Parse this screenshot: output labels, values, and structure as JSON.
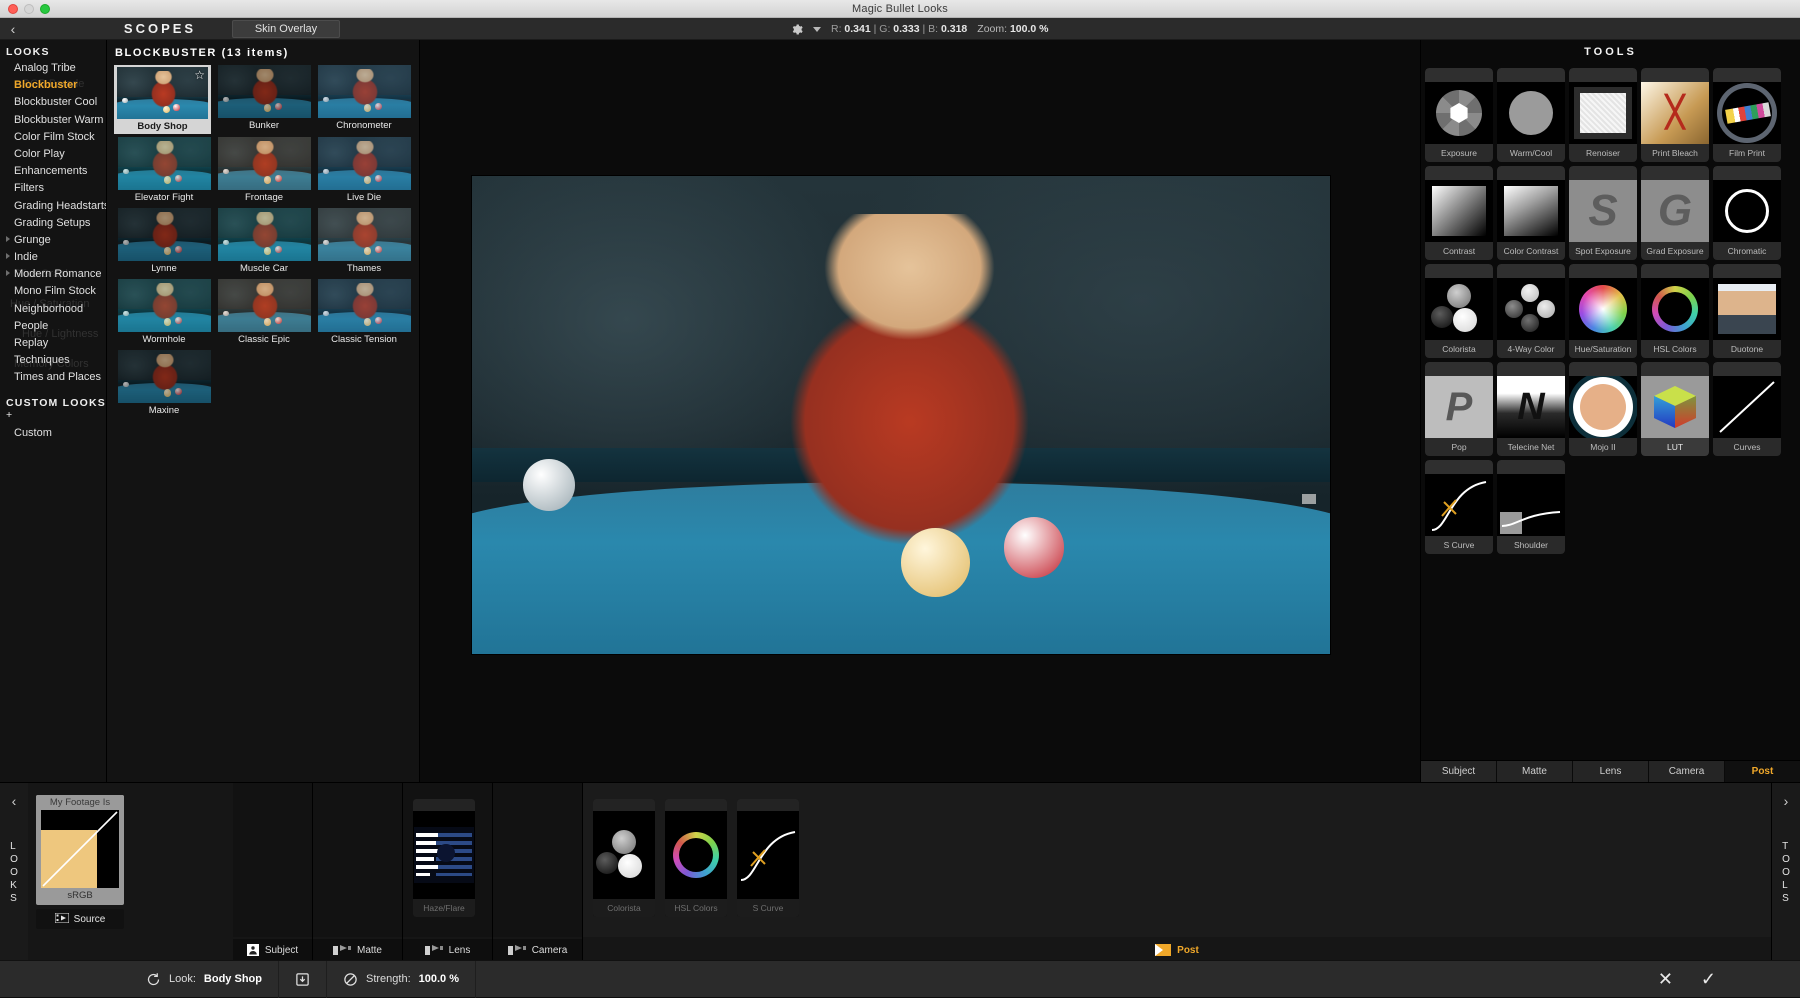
{
  "window": {
    "title": "Magic Bullet Looks"
  },
  "toolbar": {
    "back_icon": "chevron-left-icon",
    "scopes_title": "SCOPES",
    "skin_overlay_label": "Skin Overlay",
    "gear_icon": "gear-icon",
    "caret_icon": "chevron-down-icon",
    "rgb_readout": {
      "r_label": "R:",
      "r": "0.341",
      "sep": "|",
      "g_label": "G:",
      "g": "0.333",
      "b_label": "B:",
      "b": "0.318"
    },
    "zoom_label": "Zoom:",
    "zoom_value": "100.0 %"
  },
  "sidebar": {
    "heading": "LOOKS",
    "custom_heading": "CUSTOM LOOKS",
    "custom_plus": "+",
    "ghost_labels": [
      "RGB Parade",
      "Slice Graph",
      "Hue / Saturation",
      "Hue / Lightness",
      "Memory Colors"
    ],
    "items": [
      {
        "label": "Analog Tribe",
        "selected": false,
        "expandable": false
      },
      {
        "label": "Blockbuster",
        "selected": true,
        "expandable": false
      },
      {
        "label": "Blockbuster Cool",
        "selected": false,
        "expandable": false
      },
      {
        "label": "Blockbuster Warm",
        "selected": false,
        "expandable": false
      },
      {
        "label": "Color Film Stock",
        "selected": false,
        "expandable": false
      },
      {
        "label": "Color Play",
        "selected": false,
        "expandable": false
      },
      {
        "label": "Enhancements",
        "selected": false,
        "expandable": false
      },
      {
        "label": "Filters",
        "selected": false,
        "expandable": false
      },
      {
        "label": "Grading Headstarts",
        "selected": false,
        "expandable": false
      },
      {
        "label": "Grading Setups",
        "selected": false,
        "expandable": false
      },
      {
        "label": "Grunge",
        "selected": false,
        "expandable": true
      },
      {
        "label": "Indie",
        "selected": false,
        "expandable": true
      },
      {
        "label": "Modern Romance",
        "selected": false,
        "expandable": true
      },
      {
        "label": "Mono Film Stock",
        "selected": false,
        "expandable": false
      },
      {
        "label": "Neighborhood",
        "selected": false,
        "expandable": false
      },
      {
        "label": "People",
        "selected": false,
        "expandable": false
      },
      {
        "label": "Replay",
        "selected": false,
        "expandable": false
      },
      {
        "label": "Techniques",
        "selected": false,
        "expandable": false
      },
      {
        "label": "Times and Places",
        "selected": false,
        "expandable": false
      }
    ],
    "custom_items": [
      {
        "label": "Custom"
      }
    ]
  },
  "looks_grid": {
    "title": "BLOCKBUSTER (13 items)",
    "star_icon": "star-outline-icon",
    "items": [
      {
        "label": "Body Shop",
        "active": true,
        "tint": "tint-none",
        "starred": true
      },
      {
        "label": "Bunker",
        "active": false,
        "tint": "tint-dark"
      },
      {
        "label": "Chronometer",
        "active": false,
        "tint": "tint-cool"
      },
      {
        "label": "Elevator Fight",
        "active": false,
        "tint": "tint-teal"
      },
      {
        "label": "Frontage",
        "active": false,
        "tint": "tint-warm"
      },
      {
        "label": "Live Die",
        "active": false,
        "tint": "tint-cool"
      },
      {
        "label": "Lynne",
        "active": false,
        "tint": "tint-dark"
      },
      {
        "label": "Muscle Car",
        "active": false,
        "tint": "tint-teal"
      },
      {
        "label": "Thames",
        "active": false,
        "tint": "tint-muted"
      },
      {
        "label": "Wormhole",
        "active": false,
        "tint": "tint-teal"
      },
      {
        "label": "Classic Epic",
        "active": false,
        "tint": "tint-warm"
      },
      {
        "label": "Classic Tension",
        "active": false,
        "tint": "tint-cool"
      },
      {
        "label": "Maxine",
        "active": false,
        "tint": "tint-dark"
      }
    ]
  },
  "tools": {
    "title": "TOOLS",
    "items": [
      {
        "label": "Exposure",
        "icon": "aperture-icon",
        "selected": false
      },
      {
        "label": "Warm/Cool",
        "icon": "gray-sphere-icon",
        "selected": false
      },
      {
        "label": "Renoiser",
        "icon": "noise-square-icon",
        "selected": false
      },
      {
        "label": "Print Bleach Bypass",
        "icon": "bleach-x-icon",
        "selected": false
      },
      {
        "label": "Film Print",
        "icon": "film-reel-icon",
        "selected": false
      },
      {
        "label": "Contrast",
        "icon": "bw-gradient-icon",
        "selected": false
      },
      {
        "label": "Color Contrast",
        "icon": "bw-gradient2-icon",
        "selected": false
      },
      {
        "label": "Spot Exposure",
        "icon": "letter-s-icon",
        "selected": false
      },
      {
        "label": "Grad Exposure",
        "icon": "letter-g-icon",
        "selected": false
      },
      {
        "label": "Chromatic Aberration",
        "icon": "white-ring-icon",
        "selected": false
      },
      {
        "label": "Colorista",
        "icon": "three-spheres-icon",
        "selected": false
      },
      {
        "label": "4-Way Color",
        "icon": "four-spheres-icon",
        "selected": false
      },
      {
        "label": "Hue/Saturation",
        "icon": "hue-wheel-icon",
        "selected": false
      },
      {
        "label": "HSL Colors",
        "icon": "hsl-ring-icon",
        "selected": false
      },
      {
        "label": "Duotone",
        "icon": "duotone-bars-icon",
        "selected": false
      },
      {
        "label": "Pop",
        "icon": "letter-p-icon",
        "selected": false
      },
      {
        "label": "Telecine Net",
        "icon": "letter-n-icon",
        "selected": false
      },
      {
        "label": "Mojo II",
        "icon": "mojo-ring-icon",
        "selected": false
      },
      {
        "label": "LUT",
        "icon": "color-cube-icon",
        "selected": true
      },
      {
        "label": "Curves",
        "icon": "diagonal-curve-icon",
        "selected": false
      },
      {
        "label": "S Curve",
        "icon": "s-curve-icon",
        "selected": false
      },
      {
        "label": "Shoulder",
        "icon": "shoulder-curve-icon",
        "selected": false
      }
    ],
    "tabs": [
      {
        "label": "Subject",
        "active": false
      },
      {
        "label": "Matte",
        "active": false
      },
      {
        "label": "Lens",
        "active": false
      },
      {
        "label": "Camera",
        "active": false
      },
      {
        "label": "Post",
        "active": true
      }
    ]
  },
  "timeline": {
    "left_rail": {
      "arrow_icon": "chevron-left-icon",
      "letters": [
        "L",
        "O",
        "O",
        "K",
        "S"
      ]
    },
    "right_rail": {
      "arrow_icon": "chevron-right-icon",
      "letters": [
        "T",
        "O",
        "O",
        "L",
        "S"
      ]
    },
    "footage_card": {
      "title": "My Footage Is",
      "colorspace": "sRGB"
    },
    "source_button": {
      "label": "Source",
      "icon": "film-strip-icon"
    },
    "stages": [
      {
        "label": "Subject",
        "icon": "person-icon",
        "active": false,
        "chips": []
      },
      {
        "label": "Matte",
        "icon": "matte-flag-icon",
        "active": false,
        "chips": []
      },
      {
        "label": "Lens",
        "icon": "lens-flag-icon",
        "active": false,
        "chips": [
          {
            "label": "Haze/Flare",
            "icon": "haze-flare-icon"
          }
        ]
      },
      {
        "label": "Camera",
        "icon": "camera-flag-icon",
        "active": false,
        "chips": []
      },
      {
        "label": "Post",
        "icon": "post-flag-icon",
        "active": true,
        "chips": [
          {
            "label": "Colorista",
            "icon": "three-spheres-icon"
          },
          {
            "label": "HSL Colors",
            "icon": "hsl-ring-icon"
          },
          {
            "label": "S Curve",
            "icon": "s-curve-icon"
          }
        ]
      }
    ]
  },
  "statusbar": {
    "reset_icon": "reset-arrow-icon",
    "look_label": "Look:",
    "look_value": "Body Shop",
    "save_icon": "save-down-icon",
    "disable_icon": "no-entry-icon",
    "strength_label": "Strength:",
    "strength_value": "100.0 %",
    "cancel_icon": "close-x-icon",
    "confirm_icon": "check-icon"
  },
  "colors": {
    "accent": "#f0a82a",
    "panel": "#131313",
    "chrome": "#2b2b2b"
  }
}
